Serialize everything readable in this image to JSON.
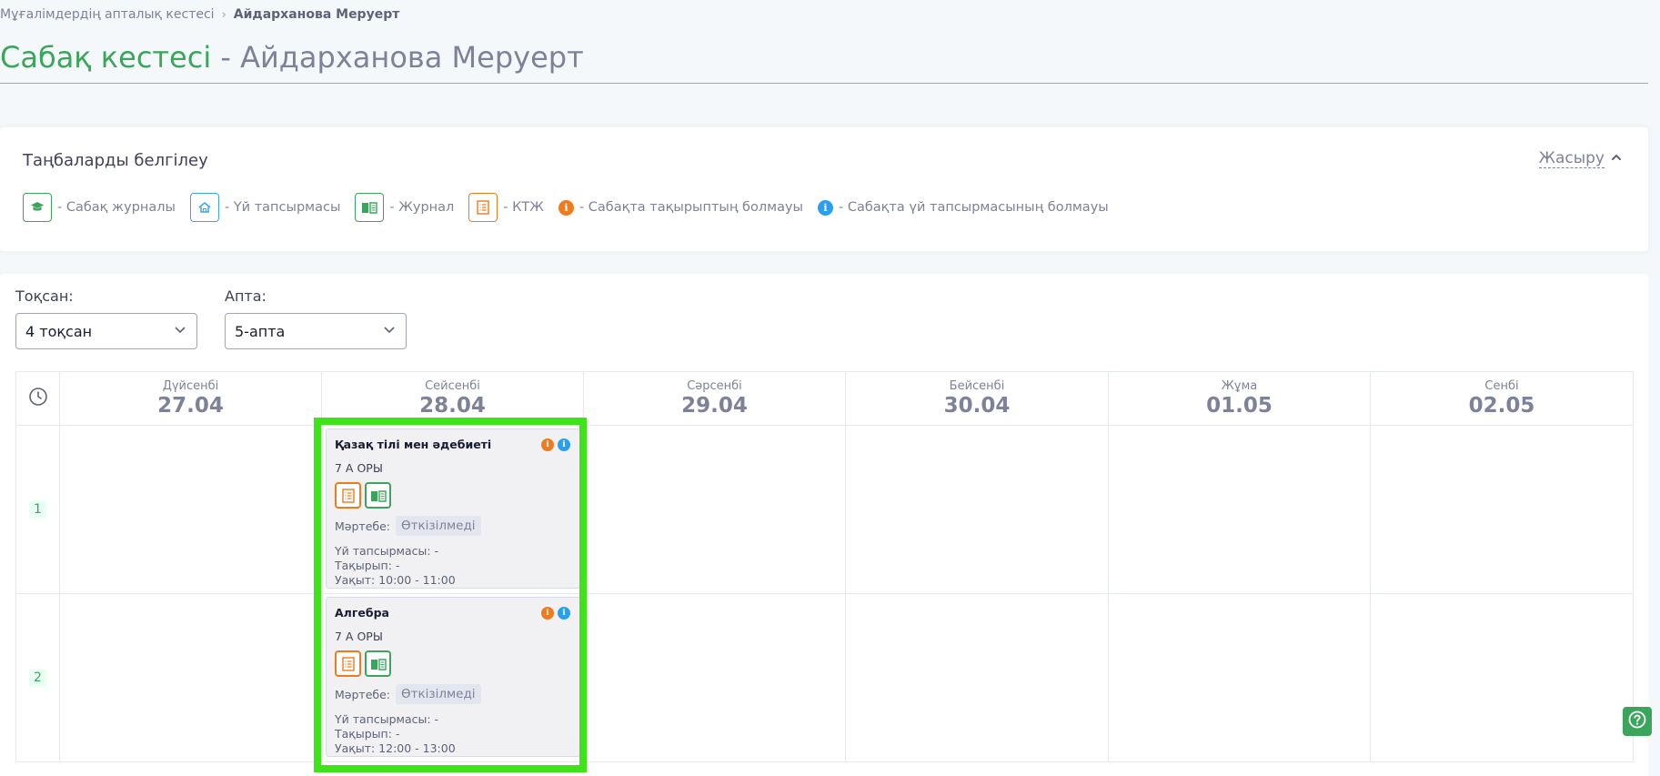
{
  "breadcrumb": {
    "parent": "Мұғалімдердің апталық кестесі",
    "current": "Айдарханова Меруерт"
  },
  "title": {
    "main": "Сабақ кестесі",
    "suffix": " - Айдарханова Меруерт"
  },
  "legend": {
    "title": "Таңбаларды белгілеу",
    "hide_label": "Жасыру",
    "items": [
      {
        "label": "- Сабақ журналы",
        "icon": "graduation-cap-icon",
        "color": "#3ba55c"
      },
      {
        "label": "- Үй тапсырмасы",
        "icon": "home-icon",
        "color": "#3da6e8"
      },
      {
        "label": "- Журнал",
        "icon": "journal-book-icon",
        "color": "#3ba55c"
      },
      {
        "label": "- КТЖ",
        "icon": "list-document-icon",
        "color": "#f07b1d"
      },
      {
        "label": "- Сабақта тақырыптың болмауы",
        "icon": "info-dot-orange-icon",
        "color": "#f07b1d"
      },
      {
        "label": "- Сабақта үй тапсырмасының болмауы",
        "icon": "info-dot-blue-icon",
        "color": "#2a9ff0"
      }
    ]
  },
  "filters": {
    "quarter_label": "Тоқсан:",
    "quarter_value": "4 тоқсан",
    "week_label": "Апта:",
    "week_value": "5-апта"
  },
  "days": [
    {
      "name": "Дүйсенбі",
      "date": "27.04"
    },
    {
      "name": "Сейсенбі",
      "date": "28.04"
    },
    {
      "name": "Сәрсенбі",
      "date": "29.04"
    },
    {
      "name": "Бейсенбі",
      "date": "30.04"
    },
    {
      "name": "Жұма",
      "date": "01.05"
    },
    {
      "name": "Сенбі",
      "date": "02.05"
    }
  ],
  "rows": [
    "1",
    "2"
  ],
  "lessons": [
    {
      "subject": "Қазақ тілі мен әдебиеті",
      "class": "7 А ОРЫ",
      "status_label": "Мәртебе:",
      "status": "Өткізілмеді",
      "homework": "Үй тапсырмасы: -",
      "topic": "Тақырып: -",
      "time": "Уақыт: 10:00 - 11:00"
    },
    {
      "subject": "Алгебра",
      "class": "7 А ОРЫ",
      "status_label": "Мәртебе:",
      "status": "Өткізілмеді",
      "homework": "Үй тапсырмасы: -",
      "topic": "Тақырып: -",
      "time": "Уақыт: 12:00 - 13:00"
    }
  ],
  "colors": {
    "accent_green": "#3ba55c",
    "highlight": "#3ee31a",
    "orange": "#f07b1d",
    "blue": "#2a9ff0"
  }
}
